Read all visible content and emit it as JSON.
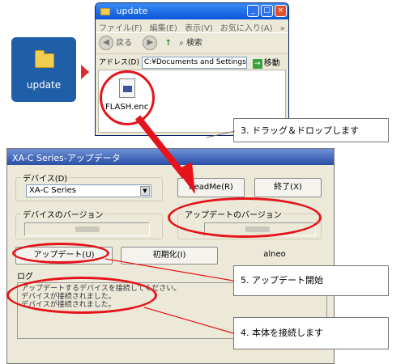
{
  "desktop": {
    "folder_label": "update"
  },
  "explorer": {
    "title": "update",
    "menu": [
      "ファイル(F)",
      "編集(E)",
      "表示(V)",
      "お気に入り(A)"
    ],
    "menu_overflow": "»",
    "back_label": "戻る",
    "search_label": "検索",
    "address_label": "アドレス(D)",
    "address_value": "C:¥Documents and Settings¥",
    "go_label": "移動",
    "file_name": "FLASH.enc"
  },
  "callouts": {
    "drag_drop": "3. ドラッグ＆ドロップします",
    "update_start": "5. アップデート開始",
    "connect": "4. 本体を接続します"
  },
  "app": {
    "title": "XA-C Series-アップデータ",
    "device_group_label": "デバイス(D)",
    "device_selected": "XA-C Series",
    "readme_button": "ReadMe(R)",
    "exit_button": "終了(X)",
    "device_version_label": "デバイスのバージョン",
    "update_version_label": "アップデートのバージョン",
    "update_button": "アップデート(U)",
    "init_button": "初期化(I)",
    "brand": "alneo",
    "log_label": "ログ",
    "log_lines": [
      "アップデートするデバイスを接続してください。",
      "デバイスが接続されました。",
      "デバイスが接続されました。"
    ]
  },
  "colors": {
    "highlight": "#e5141a",
    "title_blue": "#0b55d8"
  }
}
